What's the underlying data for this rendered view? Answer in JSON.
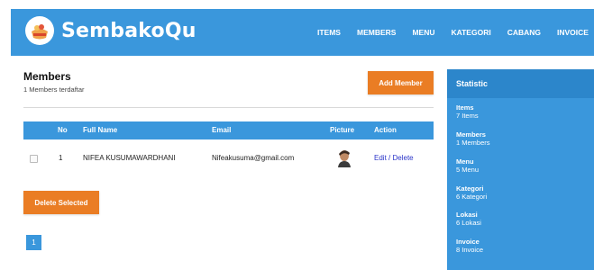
{
  "brand": {
    "name": "SembakoQu"
  },
  "nav": {
    "items": [
      "ITEMS",
      "MEMBERS",
      "MENU",
      "KATEGORI",
      "CABANG",
      "INVOICE"
    ]
  },
  "page": {
    "title": "Members",
    "subtitle": "1 Members terdaftar",
    "add_button": "Add Member",
    "delete_button": "Delete Selected"
  },
  "table": {
    "headers": [
      "No",
      "Full Name",
      "Email",
      "Picture",
      "Action"
    ],
    "rows": [
      {
        "no": "1",
        "full_name": "NIFEA KUSUMAWARDHANI",
        "email": "Nifeakusuma@gmail.com",
        "edit": "Edit",
        "separator": "/",
        "delete": "Delete"
      }
    ]
  },
  "pagination": {
    "current": "1"
  },
  "statistic": {
    "title": "Statistic",
    "items": [
      {
        "label": "Items",
        "value": "7 Items"
      },
      {
        "label": "Members",
        "value": "1 Members"
      },
      {
        "label": "Menu",
        "value": "5 Menu"
      },
      {
        "label": "Kategori",
        "value": "6 Kategori"
      },
      {
        "label": "Lokasi",
        "value": "6 Lokasi"
      },
      {
        "label": "Invoice",
        "value": "8 Invoice"
      }
    ]
  },
  "colors": {
    "primary": "#3a97dc",
    "accent": "#ea7d24",
    "link": "#2b35c9"
  }
}
